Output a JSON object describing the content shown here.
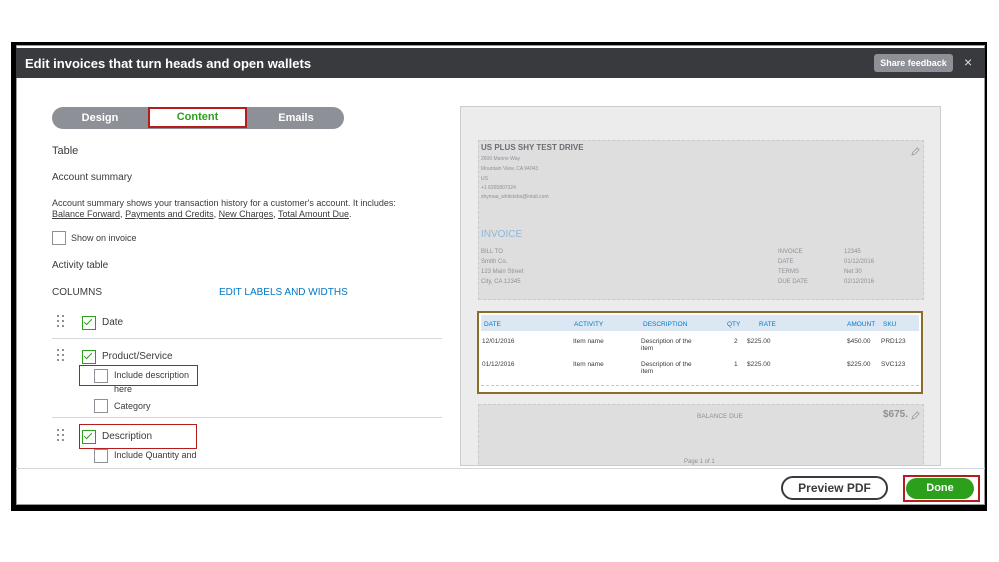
{
  "window": {
    "title": "Edit invoices that turn heads and open wallets",
    "share_feedback": "Share feedback",
    "close_glyph": "×"
  },
  "tabs": {
    "design": "Design",
    "content": "Content",
    "emails": "Emails"
  },
  "panel": {
    "section_title": "Table",
    "account_summary_heading": "Account summary",
    "account_summary_desc_line1": "Account summary shows your transaction history for a customer's account. It includes:",
    "desc_items": [
      "Balance Forward",
      "Payments and Credits",
      "New Charges",
      "Total Amount Due"
    ],
    "show_on_invoice": "Show on invoice",
    "activity_table_heading": "Activity table",
    "columns_label": "COLUMNS",
    "edit_labels_link": "EDIT LABELS AND WIDTHS",
    "columns": [
      {
        "label": "Date",
        "checked": true
      },
      {
        "label": "Product/Service",
        "checked": true
      },
      {
        "label": "Include description",
        "label_cont": "here",
        "checked": false
      },
      {
        "label": "Category",
        "checked": false
      },
      {
        "label": "Description",
        "checked": true
      },
      {
        "label": "Include Quantity and",
        "checked": false
      }
    ]
  },
  "preview": {
    "company_name": "US PLUS SHY TEST DRIVE",
    "address_lines": [
      "2600 Marine Way",
      "Mountain View, CA 94043",
      "US",
      "+1 6265807324",
      "shymaa_whitelebs@intuit.com"
    ],
    "invoice_label": "INVOICE",
    "bill_to": [
      "BILL TO",
      "Smith Co.",
      "123 Main Street",
      "City, CA 12345"
    ],
    "meta_labels": [
      "INVOICE",
      "DATE",
      "TERMS",
      "DUE DATE"
    ],
    "meta_values": [
      "12345",
      "01/12/2016",
      "Net 30",
      "02/12/2016"
    ],
    "table_headers": [
      "DATE",
      "ACTIVITY",
      "DESCRIPTION",
      "QTY",
      "RATE",
      "AMOUNT",
      "SKU"
    ],
    "rows": [
      {
        "date": "12/01/2016",
        "activity": "Item name",
        "desc1": "Description of the",
        "desc2": "item",
        "qty": "2",
        "rate": "$225.00",
        "amount": "$450.00",
        "sku": "PRD123"
      },
      {
        "date": "01/12/2016",
        "activity": "Item name",
        "desc1": "Description of the",
        "desc2": "item",
        "qty": "1",
        "rate": "$225.00",
        "amount": "$225.00",
        "sku": "SVC123"
      }
    ],
    "balance_due_label": "BALANCE DUE",
    "balance_due_value": "$675.",
    "page_label": "Page 1 of 1"
  },
  "footer": {
    "preview_pdf": "Preview PDF",
    "done": "Done"
  },
  "colors": {
    "brand_green": "#2ca01c",
    "link_blue": "#0077c5",
    "title_bar": "#393a3d",
    "highlight_red": "#b71c1c"
  }
}
